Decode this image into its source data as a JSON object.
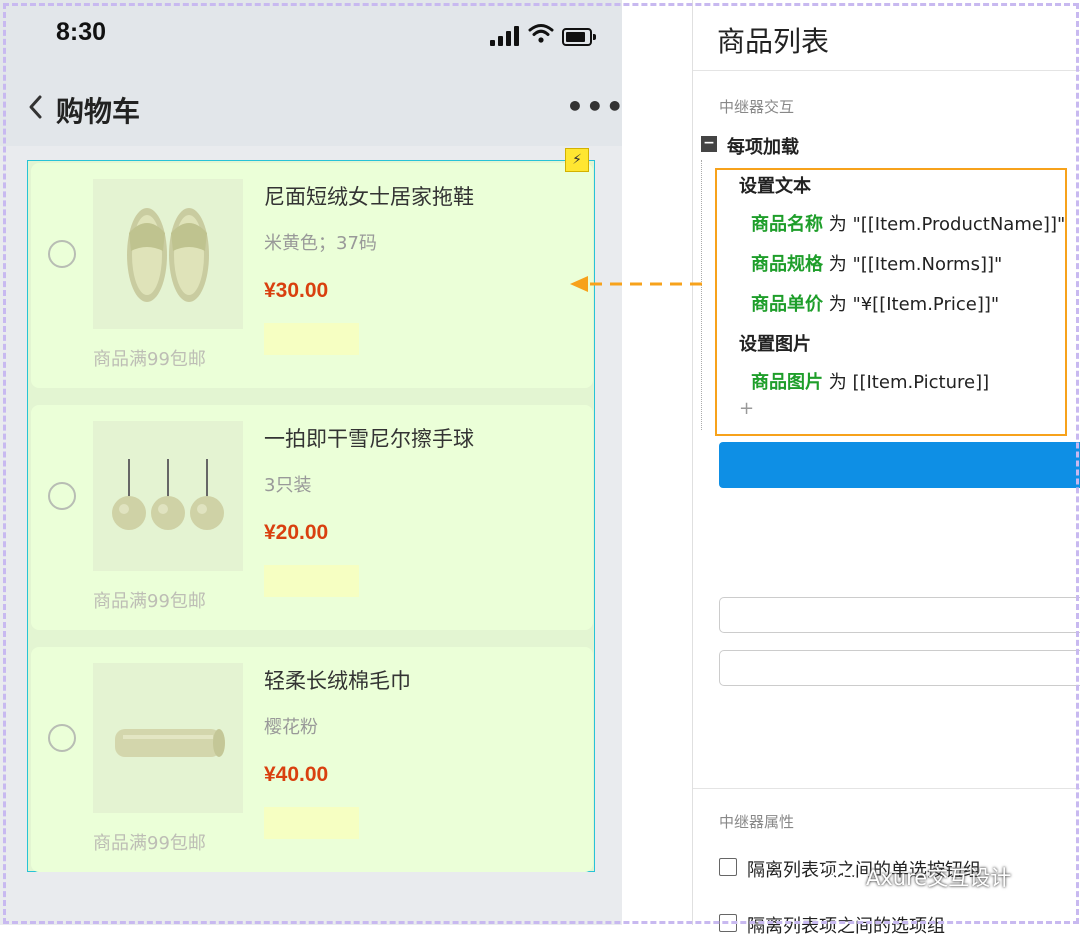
{
  "status_bar": {
    "time": "8:30"
  },
  "nav": {
    "title": "购物车"
  },
  "cart_items": [
    {
      "name": "尼面短绒女士居家拖鞋",
      "spec": "米黄色；37码",
      "price": "¥30.00",
      "shipping": "商品满99包邮",
      "image": "slippers"
    },
    {
      "name": "一拍即干雪尼尔擦手球",
      "spec": "3只装",
      "price": "¥20.00",
      "shipping": "商品满99包邮",
      "image": "hand-towel-balls"
    },
    {
      "name": "轻柔长绒棉毛巾",
      "spec": "樱花粉",
      "price": "¥40.00",
      "shipping": "商品满99包邮",
      "image": "rolled-towel"
    }
  ],
  "panel": {
    "title": "商品列表",
    "interaction_section": "中继器交互",
    "event": "每项加载",
    "actions": [
      {
        "title": "设置文本",
        "lines": [
          {
            "target": "商品名称",
            "op": " 为 ",
            "value": "\"[[Item.ProductName]]\""
          },
          {
            "target": "商品规格",
            "op": " 为 ",
            "value": "\"[[Item.Norms]]\""
          },
          {
            "target": "商品单价",
            "op": " 为 ",
            "value": "\"¥[[Item.Price]]\""
          }
        ]
      },
      {
        "title": "设置图片",
        "lines": [
          {
            "target": "商品图片",
            "op": " 为 ",
            "value": "[[Item.Picture]]"
          }
        ]
      }
    ],
    "add_symbol": "+",
    "props_section": "中继器属性",
    "checkboxes": [
      {
        "label": "隔离列表项之间的单选按钮组",
        "checked": false
      },
      {
        "label": "隔离列表项之间的选项组",
        "checked": false
      }
    ]
  },
  "watermark": "Axure交互设计",
  "colors": {
    "accent_orange": "#f7a21b",
    "target_green": "#1e9e2a",
    "price_red": "#d9400f",
    "button_blue": "#0e8fe5"
  }
}
